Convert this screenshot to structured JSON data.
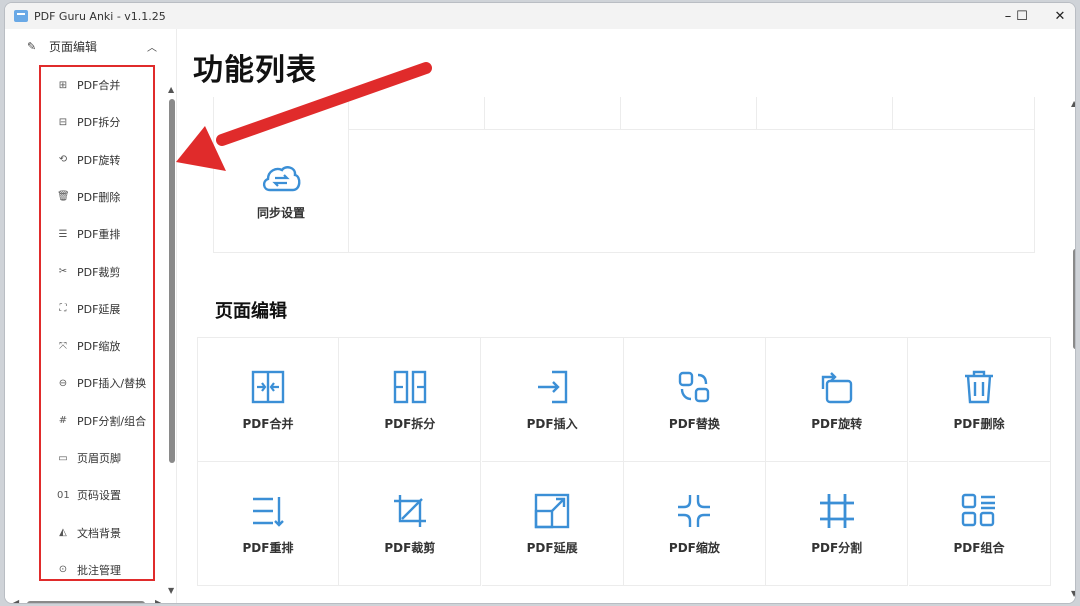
{
  "window": {
    "title": "PDF Guru Anki - v1.1.25",
    "minimize": "–",
    "maximize": "☐",
    "close": "✕"
  },
  "sidebar": {
    "section": "页面编辑",
    "items": [
      {
        "label": "PDF合并",
        "icon": "merge-icon",
        "glyph": "⊞"
      },
      {
        "label": "PDF拆分",
        "icon": "split-icon",
        "glyph": "⊟"
      },
      {
        "label": "PDF旋转",
        "icon": "rotate-icon",
        "glyph": "⟲"
      },
      {
        "label": "PDF删除",
        "icon": "trash-icon",
        "glyph": "🗑"
      },
      {
        "label": "PDF重排",
        "icon": "reorder-icon",
        "glyph": "☰"
      },
      {
        "label": "PDF裁剪",
        "icon": "scissors-icon",
        "glyph": "✂"
      },
      {
        "label": "PDF延展",
        "icon": "expand-icon",
        "glyph": "⛶"
      },
      {
        "label": "PDF缩放",
        "icon": "scale-icon",
        "glyph": "⤧"
      },
      {
        "label": "PDF插入/替换",
        "icon": "insert-icon",
        "glyph": "⊖"
      },
      {
        "label": "PDF分割/组合",
        "icon": "hash-icon",
        "glyph": "#"
      },
      {
        "label": "页眉页脚",
        "icon": "header-footer-icon",
        "glyph": "▭"
      },
      {
        "label": "页码设置",
        "icon": "page-number-icon",
        "glyph": "01"
      },
      {
        "label": "文档背景",
        "icon": "paint-bucket-icon",
        "glyph": "◭"
      },
      {
        "label": "批注管理",
        "icon": "comment-icon",
        "glyph": "⊙"
      }
    ]
  },
  "main": {
    "title": "功能列表",
    "sync_label": "同步设置",
    "section_title": "页面编辑",
    "tiles": [
      {
        "label": "PDF合并",
        "icon": "merge-icon"
      },
      {
        "label": "PDF拆分",
        "icon": "split-icon"
      },
      {
        "label": "PDF插入",
        "icon": "insert-icon"
      },
      {
        "label": "PDF替换",
        "icon": "replace-icon"
      },
      {
        "label": "PDF旋转",
        "icon": "rotate-icon"
      },
      {
        "label": "PDF删除",
        "icon": "trash-icon"
      },
      {
        "label": "PDF重排",
        "icon": "reorder-icon"
      },
      {
        "label": "PDF裁剪",
        "icon": "crop-icon"
      },
      {
        "label": "PDF延展",
        "icon": "expand-icon"
      },
      {
        "label": "PDF缩放",
        "icon": "scale-icon"
      },
      {
        "label": "PDF分割",
        "icon": "grid-split-icon"
      },
      {
        "label": "PDF组合",
        "icon": "combine-icon"
      }
    ]
  },
  "colors": {
    "accent": "#3b8fd6",
    "annotation": "#e02b2b"
  }
}
